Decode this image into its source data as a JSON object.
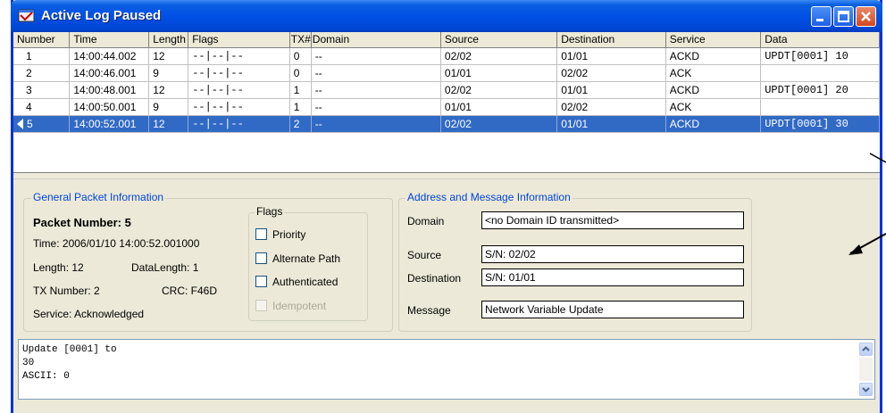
{
  "window": {
    "title": "Active Log Paused"
  },
  "table": {
    "columns": [
      "Number",
      "Time",
      "Length",
      "Flags",
      "TX#",
      "Domain",
      "Source",
      "Destination",
      "Service",
      "Data"
    ],
    "rows": [
      {
        "number": "1",
        "time": "14:00:44.002",
        "length": "12",
        "flags": "--|--|--",
        "tx": "0",
        "domain": "--",
        "source": "02/02",
        "destination": "01/01",
        "service": "ACKD",
        "data": "UPDT[0001] 10"
      },
      {
        "number": "2",
        "time": "14:00:46.001",
        "length": "9",
        "flags": "--|--|--",
        "tx": "0",
        "domain": "--",
        "source": "01/01",
        "destination": "02/02",
        "service": "ACK",
        "data": ""
      },
      {
        "number": "3",
        "time": "14:00:48.001",
        "length": "12",
        "flags": "--|--|--",
        "tx": "1",
        "domain": "--",
        "source": "02/02",
        "destination": "01/01",
        "service": "ACKD",
        "data": "UPDT[0001] 20"
      },
      {
        "number": "4",
        "time": "14:00:50.001",
        "length": "9",
        "flags": "--|--|--",
        "tx": "1",
        "domain": "--",
        "source": "01/01",
        "destination": "02/02",
        "service": "ACK",
        "data": ""
      },
      {
        "number": "5",
        "time": "14:00:52.001",
        "length": "12",
        "flags": "--|--|--",
        "tx": "2",
        "domain": "--",
        "source": "02/02",
        "destination": "01/01",
        "service": "ACKD",
        "data": "UPDT[0001] 30"
      }
    ],
    "selected_row": 5
  },
  "general": {
    "legend": "General Packet Information",
    "packet_number": "Packet Number: 5",
    "time": "Time: 2006/01/10 14:00:52.001000",
    "length": "Length: 12",
    "data_length": "DataLength: 1",
    "tx_number": "TX Number: 2",
    "crc": "CRC: F46D",
    "service": "Service: Acknowledged"
  },
  "flags": {
    "legend": "Flags",
    "priority": "Priority",
    "alternate_path": "Alternate Path",
    "authenticated": "Authenticated",
    "idempotent": "Idempotent"
  },
  "address": {
    "legend": "Address and Message Information",
    "domain_label": "Domain",
    "domain_value": "<no Domain ID transmitted>",
    "source_label": "Source",
    "source_value": "S/N: 02/02",
    "destination_label": "Destination",
    "destination_value": "S/N: 01/01",
    "message_label": "Message",
    "message_value": "Network Variable Update"
  },
  "details": {
    "lines": [
      "Update [0001] to",
      "30",
      "ASCII: 0"
    ]
  },
  "colors": {
    "title_bar": "#0050e6",
    "selection": "#316ac5",
    "group_legend": "#0046d5"
  }
}
